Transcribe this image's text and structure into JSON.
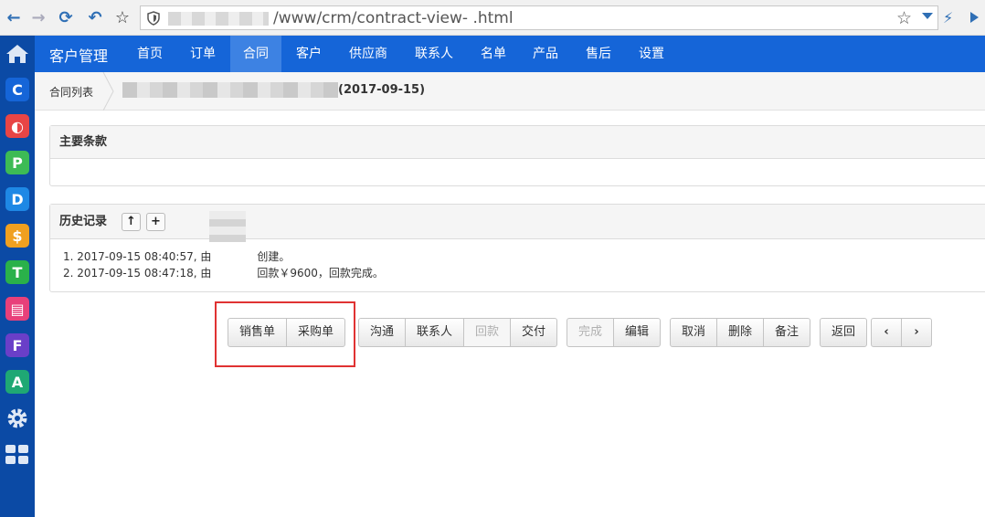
{
  "browser": {
    "url_text": "/www/crm/contract-view-   .html"
  },
  "app_icons": [
    {
      "letter": "C",
      "color": "#1565d8"
    },
    {
      "letter": "◐",
      "color": "#e84545"
    },
    {
      "letter": "P",
      "color": "#3dbb55"
    },
    {
      "letter": "D",
      "color": "#1e88e5"
    },
    {
      "letter": "$",
      "color": "#f0a020"
    },
    {
      "letter": "T",
      "color": "#2ab14a"
    },
    {
      "letter": "▤",
      "color": "#e8407a"
    },
    {
      "letter": "F",
      "color": "#6a3fc8"
    },
    {
      "letter": "A",
      "color": "#1fa874"
    }
  ],
  "topnav": {
    "brand": "客户管理",
    "items": [
      "首页",
      "订单",
      "合同",
      "客户",
      "供应商",
      "联系人",
      "名单",
      "产品",
      "售后",
      "设置"
    ],
    "active": "合同"
  },
  "breadcrumb": {
    "list": "合同列表",
    "current_suffix": "(2017-09-15)"
  },
  "panels": {
    "terms_title": "主要条款",
    "history_title": "历史记录",
    "history": [
      {
        "prefix": "1. 2017-09-15 08:40:57, 由",
        "suffix": "创建。"
      },
      {
        "prefix": "2. 2017-09-15 08:47:18, 由",
        "suffix": "回款￥9600，回款完成。"
      }
    ]
  },
  "buttons": {
    "group1": [
      "销售单",
      "采购单"
    ],
    "group2": [
      "沟通",
      "联系人",
      "回款",
      "交付"
    ],
    "group3": [
      "完成",
      "编辑"
    ],
    "group4": [
      "取消",
      "删除",
      "备注"
    ],
    "back": "返回"
  }
}
